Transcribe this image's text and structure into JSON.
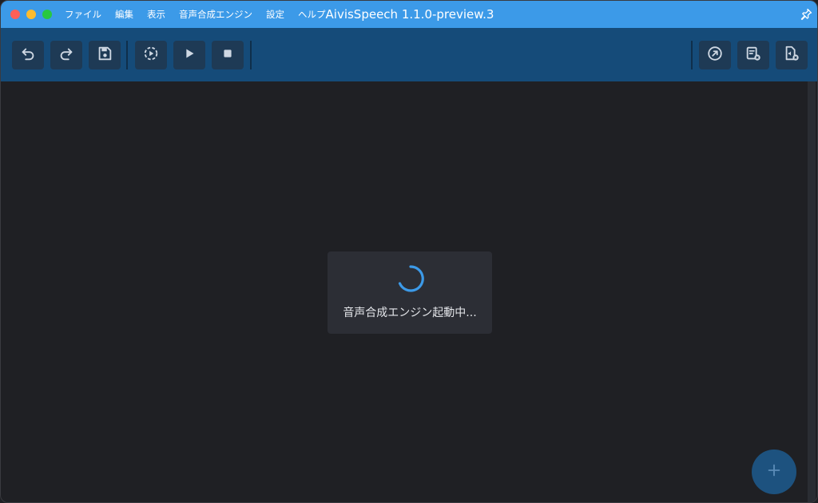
{
  "window": {
    "title": "AivisSpeech 1.1.0-preview.3"
  },
  "menu": {
    "items": [
      {
        "label": "ファイル"
      },
      {
        "label": "編集"
      },
      {
        "label": "表示"
      },
      {
        "label": "音声合成エンジン"
      },
      {
        "label": "設定"
      },
      {
        "label": "ヘルプ"
      }
    ]
  },
  "toolbar": {
    "left_icons": [
      "undo-icon",
      "redo-icon",
      "save-icon",
      "play-continuous-icon",
      "play-icon",
      "stop-icon"
    ],
    "right_icons": [
      "export-audio-icon",
      "export-text-icon",
      "export-audio-file-icon"
    ]
  },
  "loading": {
    "message": "音声合成エンジン起動中..."
  },
  "fab": {
    "icon": "plus-icon"
  },
  "colors": {
    "titlebar": "#3c9ae8",
    "toolbar": "#154b79",
    "background": "#1f2024",
    "accent": "#3c9ae8"
  }
}
